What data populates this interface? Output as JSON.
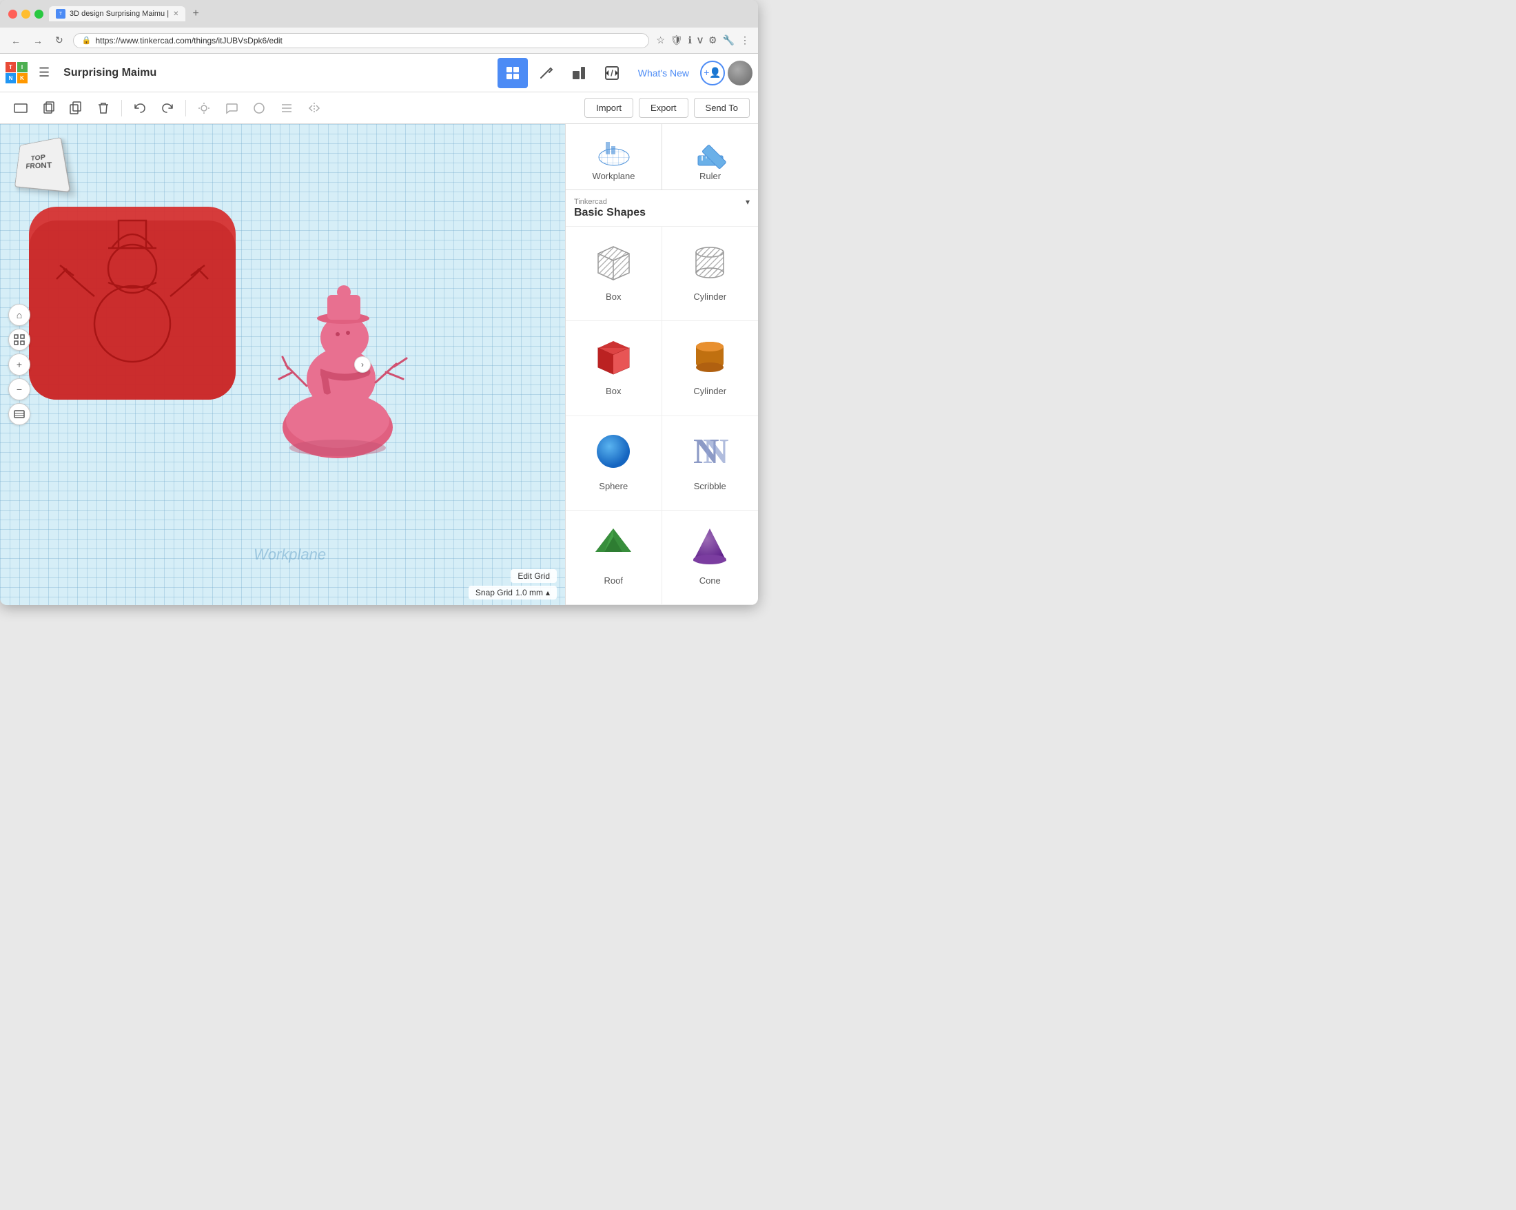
{
  "browser": {
    "tab_title": "3D design Surprising Maimu |",
    "url": "https://www.tinkercad.com/things/itJUBVsDpk6/edit",
    "new_tab_label": "+"
  },
  "header": {
    "title": "Surprising Maimu",
    "whats_new": "What's New",
    "tools": [
      "grid",
      "pickaxe",
      "shapes",
      "code"
    ],
    "import_label": "Import",
    "export_label": "Export",
    "send_to_label": "Send To"
  },
  "toolbar": {
    "buttons": [
      "workplane",
      "copy",
      "paste",
      "delete",
      "undo",
      "redo",
      "light",
      "comment",
      "circle",
      "align",
      "mirror"
    ],
    "import_label": "Import",
    "export_label": "Export",
    "send_to_label": "Send To"
  },
  "right_panel": {
    "workplane_label": "Workplane",
    "ruler_label": "Ruler",
    "category_prefix": "Tinkercad",
    "category_name": "Basic Shapes",
    "shapes": [
      {
        "label": "Box",
        "type": "box-striped",
        "color": "#c0c0c0"
      },
      {
        "label": "Cylinder",
        "type": "cylinder-striped",
        "color": "#c0c0c0"
      },
      {
        "label": "Box",
        "type": "box-solid",
        "color": "#e84040"
      },
      {
        "label": "Cylinder",
        "type": "cylinder-solid",
        "color": "#c87020"
      },
      {
        "label": "Sphere",
        "type": "sphere",
        "color": "#2196f3"
      },
      {
        "label": "Scribble",
        "type": "scribble",
        "color": "#90a0d0"
      },
      {
        "label": "Roof",
        "type": "roof",
        "color": "#3a8a3a"
      },
      {
        "label": "Cone",
        "type": "cone",
        "color": "#7030a0"
      }
    ]
  },
  "viewport": {
    "workplane_label": "Workplane",
    "view_cube_top": "TOP",
    "view_cube_front": "FRONT",
    "edit_grid_label": "Edit Grid",
    "snap_grid_label": "Snap Grid",
    "snap_grid_value": "1.0 mm"
  },
  "icons": {
    "list": "☰",
    "back": "←",
    "forward": "→",
    "refresh": "↻",
    "lock": "🔒",
    "star": "☆",
    "shield": "🛡",
    "info": "ℹ",
    "v": "V",
    "settings": "⚙",
    "more": "⋮",
    "home": "⌂",
    "fit": "⊡",
    "zoom_in": "+",
    "zoom_out": "−",
    "layers": "⊞",
    "chevron_right": "›",
    "chevron_down": "▾",
    "chevron_up": "▴"
  }
}
